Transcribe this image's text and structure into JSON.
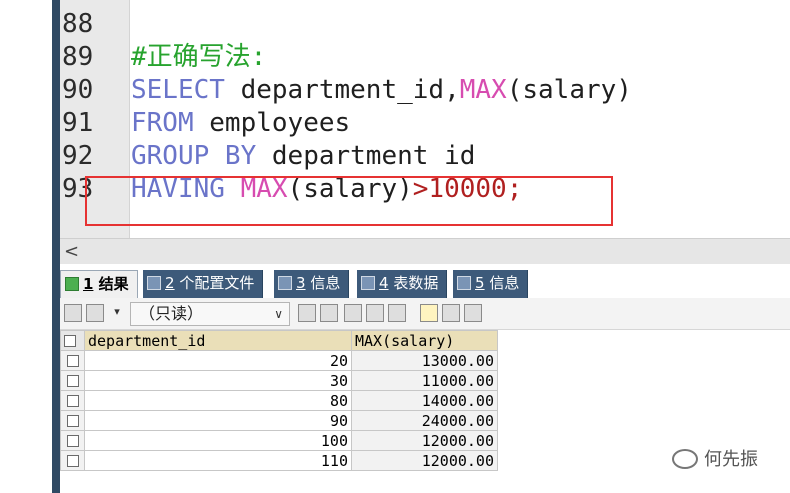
{
  "editor": {
    "lines": [
      {
        "num": "88",
        "segments": []
      },
      {
        "num": "89",
        "segments": [
          {
            "text": "#正确写法:",
            "cls": "cm"
          }
        ]
      },
      {
        "num": "90",
        "segments": [
          {
            "text": "SELECT",
            "cls": "kw"
          },
          {
            "text": " department_id,",
            "cls": "pl"
          },
          {
            "text": "MAX",
            "cls": "fn"
          },
          {
            "text": "(salary)",
            "cls": "pl"
          }
        ]
      },
      {
        "num": "91",
        "segments": [
          {
            "text": "FROM",
            "cls": "kw"
          },
          {
            "text": " employees",
            "cls": "pl"
          }
        ]
      },
      {
        "num": "92",
        "segments": [
          {
            "text": "GROUP BY",
            "cls": "kw"
          },
          {
            "text": " department id",
            "cls": "pl"
          }
        ]
      },
      {
        "num": "93",
        "segments": [
          {
            "text": "HAVING",
            "cls": "kw"
          },
          {
            "text": " ",
            "cls": "pl"
          },
          {
            "text": "MAX",
            "cls": "fn"
          },
          {
            "text": "(salary)",
            "cls": "pl"
          },
          {
            "text": ">10000;",
            "cls": "op"
          }
        ]
      }
    ]
  },
  "scrollbar": {
    "left_arrow": "<"
  },
  "tabs": [
    {
      "num": "1",
      "label": "结果",
      "icon": "result-grid-icon"
    },
    {
      "num": "2",
      "label": "个配置文件",
      "icon": "profile-icon"
    },
    {
      "num": "3",
      "label": "信息",
      "icon": "info-icon"
    },
    {
      "num": "4",
      "label": "表数据",
      "icon": "table-data-icon"
    },
    {
      "num": "5",
      "label": "信息",
      "icon": "info-icon"
    }
  ],
  "toolbar": {
    "mode_label": "（只读）"
  },
  "grid": {
    "headers": [
      "department_id",
      "MAX(salary)"
    ],
    "rows": [
      {
        "department_id": "20",
        "max_salary": "13000.00"
      },
      {
        "department_id": "30",
        "max_salary": "11000.00"
      },
      {
        "department_id": "80",
        "max_salary": "14000.00"
      },
      {
        "department_id": "90",
        "max_salary": "24000.00"
      },
      {
        "department_id": "100",
        "max_salary": "12000.00"
      },
      {
        "department_id": "110",
        "max_salary": "12000.00"
      }
    ]
  },
  "watermark": {
    "text": "何先振"
  },
  "colors": {
    "keyword": "#6a74c9",
    "function": "#d74cb0",
    "highlight_border": "#e63232",
    "tab_bar": "#3d5a7a"
  }
}
